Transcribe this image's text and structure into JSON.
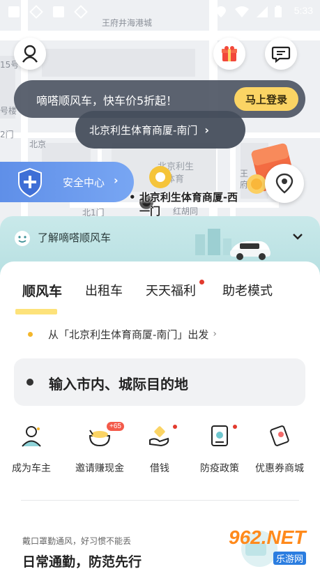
{
  "status_bar": {
    "time": "5:33"
  },
  "map": {
    "street_top": "王府井海港城",
    "street_left_1": "15号",
    "street_left_2": "号楼",
    "street_left_3": "2门",
    "street_left_4": "北京",
    "street_left_5": "北1门",
    "street_mid_1": "北京利生",
    "street_mid_2": "体育",
    "street_right_1": "王",
    "street_right_2": "府",
    "hutong": "红胡同",
    "place_name_line1": "北京利生体育商厦-西",
    "place_name_line2": "一门"
  },
  "promo": {
    "text": "嘀嗒顺风车，快车价5折起！",
    "button": "马上登录"
  },
  "pickup": {
    "text": "北京利生体育商厦-南门",
    "chevron": "›"
  },
  "safety": {
    "label": "安全中心",
    "chevron": "›"
  },
  "learn": {
    "text": "了解嘀嗒顺风车"
  },
  "tabs": [
    {
      "label": "顺风车"
    },
    {
      "label": "出租车"
    },
    {
      "label": "天天福利"
    },
    {
      "label": "助老模式"
    }
  ],
  "from": {
    "text": "从「北京利生体育商厦-南门」出发",
    "chevron": "›"
  },
  "destination": {
    "placeholder": "输入市内、城际目的地"
  },
  "services": [
    {
      "label": "成为车主",
      "icon": "driver-icon"
    },
    {
      "label": "邀请赚现金",
      "icon": "invite-cash-icon",
      "badge": "+65"
    },
    {
      "label": "借钱",
      "icon": "loan-icon"
    },
    {
      "label": "防疫政策",
      "icon": "epidemic-policy-icon"
    },
    {
      "label": "优惠券商城",
      "icon": "coupon-mall-icon"
    }
  ],
  "article": {
    "subtitle": "戴口罩勤通风，好习惯不能丢",
    "title": "日常通勤，防范先行"
  },
  "watermark": {
    "big": "962.NET",
    "small": "乐游网"
  },
  "colors": {
    "accent_yellow": "#fbd464",
    "safety_blue": "#6c9bee",
    "dot_red": "#e23a2e"
  }
}
